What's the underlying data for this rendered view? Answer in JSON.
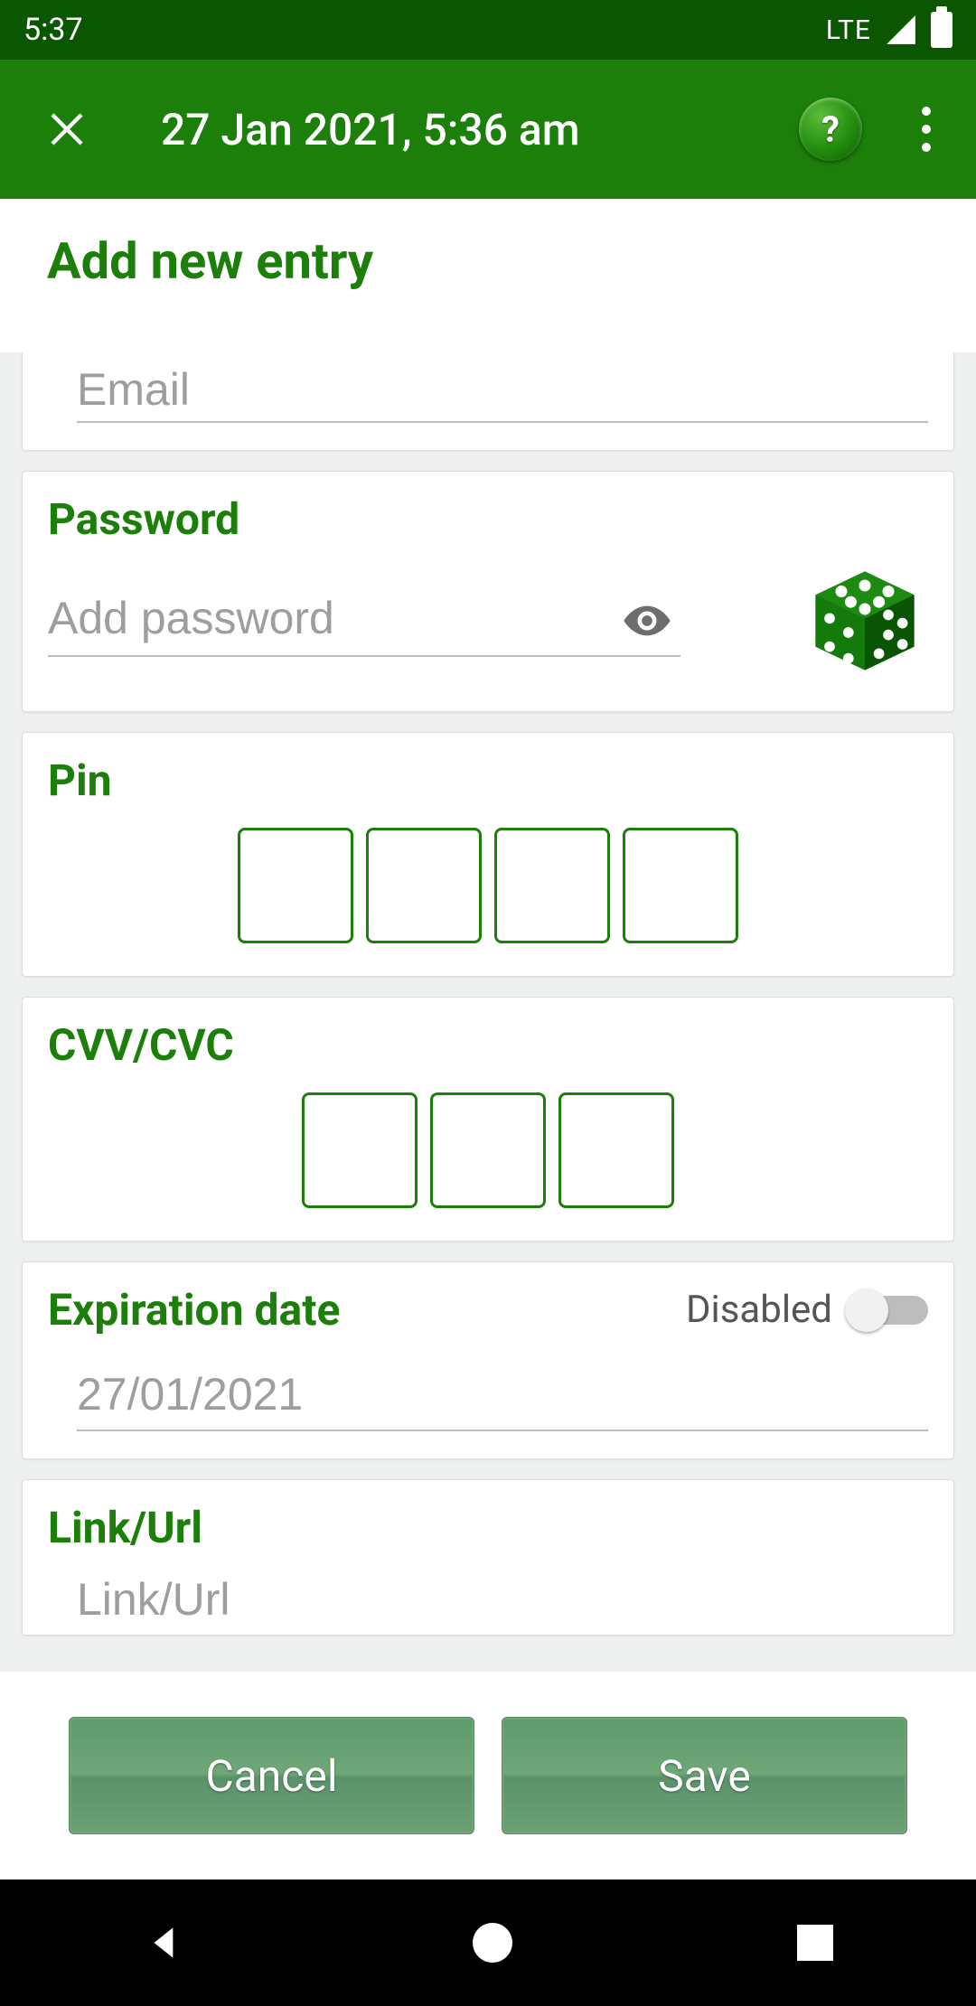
{
  "status": {
    "time": "5:37",
    "network": "LTE"
  },
  "appbar": {
    "title": "27 Jan 2021, 5:36 am"
  },
  "page": {
    "title": "Add new entry"
  },
  "email": {
    "placeholder": "Email"
  },
  "password": {
    "label": "Password",
    "placeholder": "Add password"
  },
  "pin": {
    "label": "Pin"
  },
  "cvv": {
    "label": "CVV/CVC"
  },
  "expiration": {
    "label": "Expiration date",
    "toggle_label": "Disabled",
    "placeholder": "27/01/2021"
  },
  "link": {
    "label": "Link/Url",
    "placeholder": "Link/Url"
  },
  "actions": {
    "cancel": "Cancel",
    "save": "Save"
  },
  "colors": {
    "brand_green": "#1b7f0a",
    "dark_green": "#0b5600"
  }
}
